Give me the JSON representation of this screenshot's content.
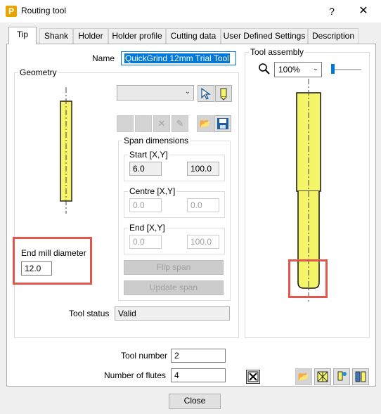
{
  "window": {
    "title": "Routing tool",
    "app_icon_letter": "P",
    "help_label": "?",
    "close_label": "✕"
  },
  "tabs": [
    {
      "label": "Tip",
      "active": true
    },
    {
      "label": "Shank"
    },
    {
      "label": "Holder"
    },
    {
      "label": "Holder profile"
    },
    {
      "label": "Cutting data"
    },
    {
      "label": "User Defined Settings"
    },
    {
      "label": "Description"
    }
  ],
  "name": {
    "label": "Name",
    "value": "QuickGrind 12mm Trial Tool"
  },
  "geometry": {
    "title": "Geometry",
    "span_dimensions": {
      "title": "Span dimensions",
      "start": {
        "title": "Start [X,Y]",
        "x": "6.0",
        "y": "100.0"
      },
      "centre": {
        "title": "Centre [X,Y]",
        "x": "0.0",
        "y": "0.0"
      },
      "end": {
        "title": "End [X,Y]",
        "x": "0.0",
        "y": "100.0"
      }
    },
    "flip_span_label": "Flip span",
    "update_span_label": "Update span",
    "end_mill_diameter": {
      "label": "End mill diameter",
      "value": "12.0"
    },
    "tool_status": {
      "label": "Tool status",
      "value": "Valid"
    }
  },
  "tool_assembly": {
    "title": "Tool assembly",
    "zoom": "100%"
  },
  "tool_number": {
    "label": "Tool number",
    "value": "2"
  },
  "number_of_flutes": {
    "label": "Number of flutes",
    "value": "4"
  },
  "close_button": "Close",
  "colors": {
    "tool_fill": "#f5f56a",
    "highlight": "#e2574c",
    "accent": "#0078d7"
  }
}
